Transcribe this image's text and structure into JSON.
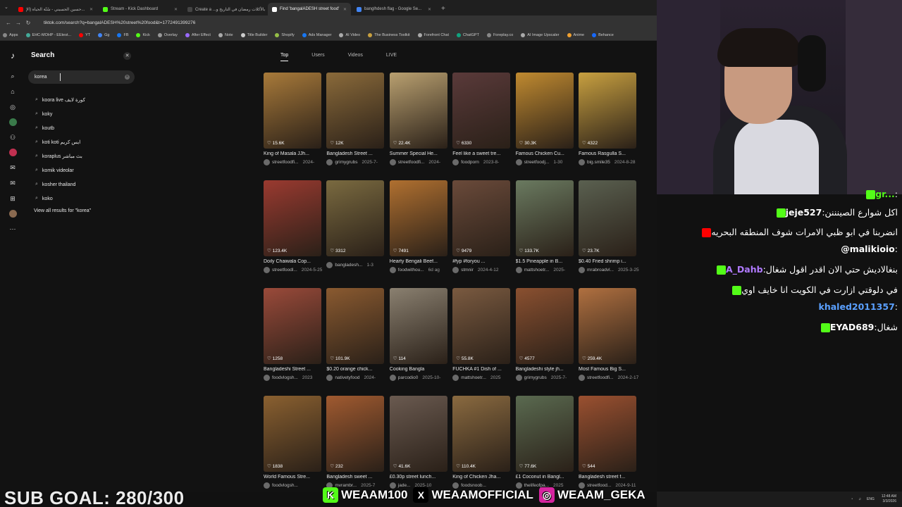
{
  "browser": {
    "tabs": [
      {
        "title": "حسين الحسيني - سُنّة الحياة (الإ...",
        "color": "#ff0000",
        "active": false
      },
      {
        "title": "Stream - Kick Dashboard",
        "color": "#53fc18",
        "active": false
      },
      {
        "title": "Create a ...بالأكلات رمضان في التاريخ و",
        "color": "#444",
        "active": false
      },
      {
        "title": "Find 'bangalADESH street food'",
        "color": "#ffffff",
        "active": true
      },
      {
        "title": "banglhdesh flag - Google Se...",
        "color": "#4285f4",
        "active": false
      }
    ],
    "url": "tiktok.com/search?q=bangalADESH%20street%20food&t=1772491399276",
    "bookmarks": [
      "Apps",
      "EHC-MOHP - EEtest...",
      "YT",
      "Gg",
      "FB",
      "Kick",
      "Overlay",
      "After Effect",
      "Note",
      "Title Builder",
      "Shopify",
      "Ads Manager",
      "AI Video",
      "The Business Toolkit",
      "Forefront Chat",
      "ChatGPT",
      "Foreplay.co",
      "AI Image Upscaler",
      "Anime",
      "Behance"
    ]
  },
  "search_panel": {
    "title": "Search",
    "query": "korea",
    "suggestions": [
      "koora live كورة لايف",
      "koky",
      "koutb",
      "koti koti ايس كريم",
      "koraplus بث مباشر",
      "komik videolar",
      "kosher thailand",
      "koko"
    ],
    "view_all": "View all results for \"korea\""
  },
  "result_tabs": [
    "Top",
    "Users",
    "Videos",
    "LIVE"
  ],
  "videos": [
    {
      "views": "15.6K",
      "caption": "King of Masala JJh...",
      "user": "streetfoodfi...",
      "date": "2024-",
      "color": "#a87a3a"
    },
    {
      "views": "12K",
      "caption": "Bangladesh Street ...",
      "user": "grimygrubs",
      "date": "2025-7-",
      "color": "#8a6a3a"
    },
    {
      "views": "22.4K",
      "caption": "Summer Special He...",
      "user": "streetfoodfi...",
      "date": "2024-",
      "color": "#b9a070"
    },
    {
      "views": "6330",
      "caption": "Feel like a sweet tre...",
      "user": "foodporn",
      "date": "2023-8-",
      "color": "#5a3a3a"
    },
    {
      "views": "30.3K",
      "caption": "Famous Chicken Cu...",
      "user": "streetfoodj...",
      "date": "1-30",
      "color": "#c08a30"
    },
    {
      "views": "4322",
      "caption": "Famous Rasgulla S...",
      "user": "big.smile35",
      "date": "2024-8-28",
      "color": "#c8a040"
    },
    {
      "views": "123.4K",
      "caption": "Doily Chaiwala Cop...",
      "user": "streetfoodl...",
      "date": "2024-5-25",
      "color": "#9a3a30"
    },
    {
      "views": "3312",
      "caption": "",
      "user": "bangladesh...",
      "date": "1-3",
      "color": "#7a6a40"
    },
    {
      "views": "7491",
      "caption": "Hearty Bengali Beef...",
      "user": "foodwithou...",
      "date": "6d ag",
      "color": "#b07030"
    },
    {
      "views": "9479",
      "caption": "#fyp #foryou ...",
      "user": "stmnir",
      "date": "2024-4-12",
      "color": "#6a4a3a"
    },
    {
      "views": "133.7K",
      "caption": "$1.5 Pineapple in B...",
      "user": "mattshoetr...",
      "date": "2025-",
      "color": "#6a7a60"
    },
    {
      "views": "23.7K",
      "caption": "$0.40 Fried shrimp i...",
      "user": "mrabroadvl...",
      "date": "2025-3-25",
      "color": "#5a6050"
    },
    {
      "views": "1258",
      "caption": "Bangladeshi Street ...",
      "user": "foodvlogsh...",
      "date": "2023",
      "color": "#9a4a3a"
    },
    {
      "views": "101.9K",
      "caption": "$0.20 orange chick...",
      "user": "nativetyfood",
      "date": "2024-",
      "color": "#8a5a30"
    },
    {
      "views": "114",
      "caption": "Cooking Bangla",
      "user": "parcodio0",
      "date": "2025-10-",
      "color": "#8a8070"
    },
    {
      "views": "55.8K",
      "caption": "FUCHKA #1 Dish of ...",
      "user": "mattshoetr...",
      "date": "2025",
      "color": "#7a5a40"
    },
    {
      "views": "4577",
      "caption": "Bangladeshi style jh...",
      "user": "grimygrubs",
      "date": "2025-7-",
      "color": "#8a5030"
    },
    {
      "views": "259.4K",
      "caption": "Most Famous Big S...",
      "user": "streetfoodfi...",
      "date": "2024-2-17",
      "color": "#b07040"
    },
    {
      "views": "1838",
      "caption": "World Famous Stre...",
      "user": "foodvlogsh...",
      "date": "",
      "color": "#8a6030"
    },
    {
      "views": "232",
      "caption": "Bangladesh sweet ...",
      "user": "mvrambr...",
      "date": "2025-7",
      "color": "#a05a30"
    },
    {
      "views": "41.6K",
      "caption": "£0.30p street lunch...",
      "user": "jade...",
      "date": "2025-10",
      "color": "#6a5a50"
    },
    {
      "views": "110.4K",
      "caption": "King of Chicken Jha...",
      "user": "foodsnoob...",
      "date": "",
      "color": "#8a6a40"
    },
    {
      "views": "77.6K",
      "caption": "£1 Coconut in Bangl...",
      "user": "thelifeofpa...",
      "date": "2025",
      "color": "#5a6a50"
    },
    {
      "views": "544",
      "caption": "Bangladesh street f...",
      "user": "streetfood...",
      "date": "2024-9-11",
      "color": "#9a5030"
    }
  ],
  "chat": [
    {
      "user": "gr...",
      "text": "",
      "badge": "kick"
    },
    {
      "user": "jeje527",
      "text": "اكل شوارع الصينننن",
      "badge": "kick"
    },
    {
      "user": "@malikioio",
      "text": "انضربنا في ابو ظبي الامرات شوف المنطقه البحريه",
      "badge": "youtube"
    },
    {
      "user": "A_Dahb",
      "text": "بنغالاديش حتي الان اقدر اقول شغال",
      "badge": "kick"
    },
    {
      "user": "khaled2011357",
      "text": "في دلوقتي ازارت في الكويت انا خايف اوي",
      "badge": "kick"
    },
    {
      "user": "EYAD689",
      "text": "شغال",
      "badge": "kick"
    }
  ],
  "overlay": {
    "sub_goal": "SUB GOAL: 280/300",
    "socials": [
      {
        "handle": "WEAAM100",
        "icon": "K",
        "color": "#53fc18"
      },
      {
        "handle": "WEAAMOFFICIAL",
        "icon": "X",
        "color": "#000000"
      },
      {
        "handle": "WEAAM_GEKA",
        "icon": "◎",
        "color": "#d6249f"
      }
    ]
  },
  "taskbar": {
    "lang": "ENG",
    "time": "12:48 AM",
    "date": "3/3/2026"
  }
}
